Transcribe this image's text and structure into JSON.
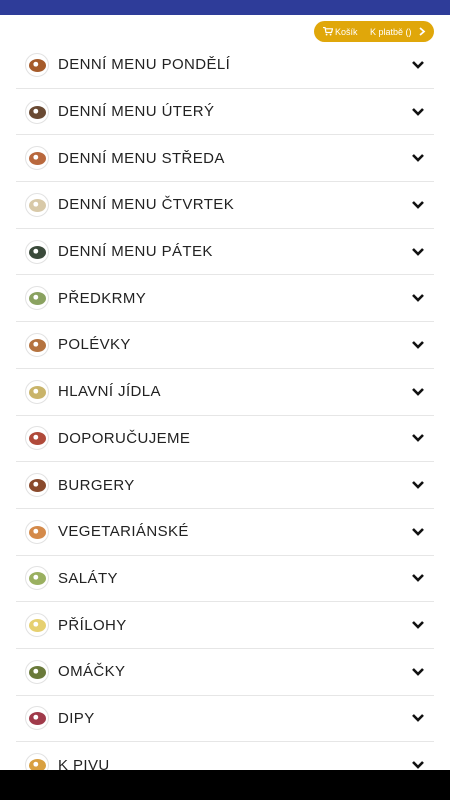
{
  "header": {
    "bar_color": "#2e3c99",
    "cart_label": "Košík",
    "checkout_label": "K platbě ()",
    "button_color": "#e0a70a"
  },
  "menu": {
    "items": [
      {
        "label": "DENNÍ MENU PONDĚLÍ",
        "thumb_color": "#a65b2a"
      },
      {
        "label": "DENNÍ MENU ÚTERÝ",
        "thumb_color": "#6a4a33"
      },
      {
        "label": "DENNÍ MENU STŘEDA",
        "thumb_color": "#b9683d"
      },
      {
        "label": "DENNÍ MENU ČTVRTEK",
        "thumb_color": "#d8c9a8"
      },
      {
        "label": "DENNÍ MENU PÁTEK",
        "thumb_color": "#3a4a3a"
      },
      {
        "label": "PŘEDKRMY",
        "thumb_color": "#8aa260"
      },
      {
        "label": "POLÉVKY",
        "thumb_color": "#b5733f"
      },
      {
        "label": "HLAVNÍ JÍDLA",
        "thumb_color": "#c9b46a"
      },
      {
        "label": "DOPORUČUJEME",
        "thumb_color": "#b04a3a"
      },
      {
        "label": "BURGERY",
        "thumb_color": "#8a4a2c"
      },
      {
        "label": "VEGETARIÁNSKÉ",
        "thumb_color": "#d48a4a"
      },
      {
        "label": "SALÁTY",
        "thumb_color": "#9ab060"
      },
      {
        "label": "PŘÍLOHY",
        "thumb_color": "#e6d070"
      },
      {
        "label": "OMÁČKY",
        "thumb_color": "#6a7a3a"
      },
      {
        "label": "DIPY",
        "thumb_color": "#a03a4a"
      },
      {
        "label": "K PIVU",
        "thumb_color": "#d9a040"
      }
    ]
  }
}
